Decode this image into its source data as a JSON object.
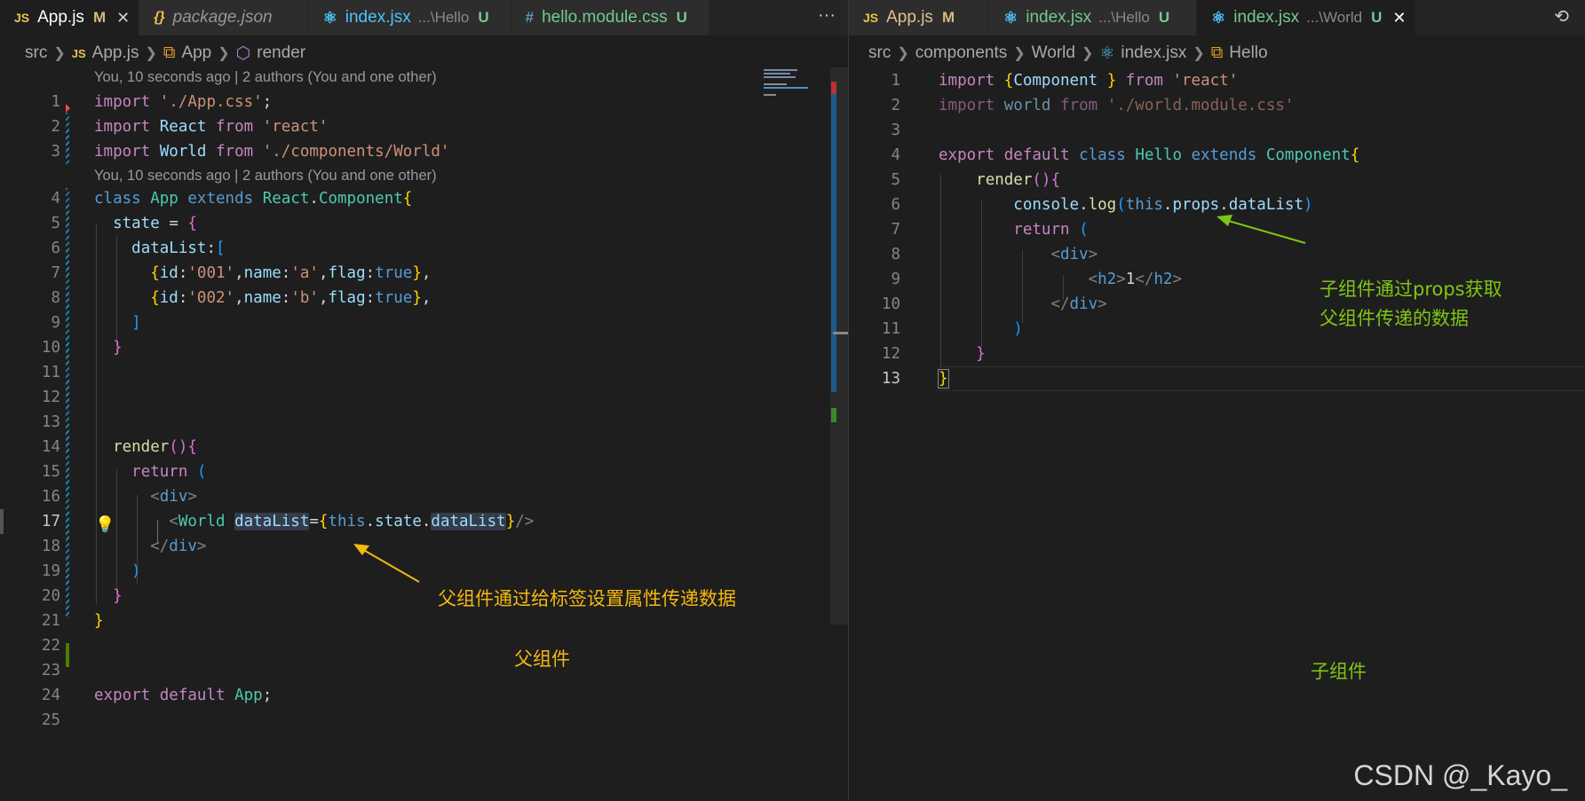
{
  "left": {
    "tabs": [
      {
        "icon": "JS",
        "label": "App.js",
        "status": "M",
        "active": true
      },
      {
        "icon": "{}",
        "label": "package.json",
        "status": ""
      },
      {
        "icon": "react",
        "label": "index.jsx",
        "path": "...\\Hello",
        "status": "U"
      },
      {
        "icon": "#",
        "label": "hello.module.css",
        "status": "U"
      }
    ],
    "more": "···",
    "breadcrumb": {
      "folder": "src",
      "file": "App.js",
      "cls": "App",
      "method": "render"
    },
    "lens_text": "You, 10 seconds ago | 2 authors (You and one other)",
    "annotation_child_pass": "父组件通过给标签设置属性传递数据",
    "annotation_parent": "父组件"
  },
  "right": {
    "tabs": [
      {
        "icon": "JS",
        "label": "App.js",
        "status": "M"
      },
      {
        "icon": "react",
        "label": "index.jsx",
        "path": "...\\Hello",
        "status": "U"
      },
      {
        "icon": "react",
        "label": "index.jsx",
        "path": "...\\World",
        "status": "U",
        "active": true
      }
    ],
    "breadcrumb": {
      "folder1": "src",
      "folder2": "components",
      "folder3": "World",
      "file": "index.jsx",
      "cls": "Hello"
    },
    "annotation_props_1": "子组件通过props获取",
    "annotation_props_2": "父组件传递的数据",
    "annotation_child": "子组件"
  },
  "watermark": "CSDN @_Kayo_",
  "colors": {
    "keyword": "#569cd6",
    "control": "#c586c0",
    "string": "#ce9178",
    "variable": "#9cdcfe",
    "type": "#4ec9b0",
    "annotation_yellow": "#f5b80e",
    "annotation_green": "#7ec614"
  }
}
